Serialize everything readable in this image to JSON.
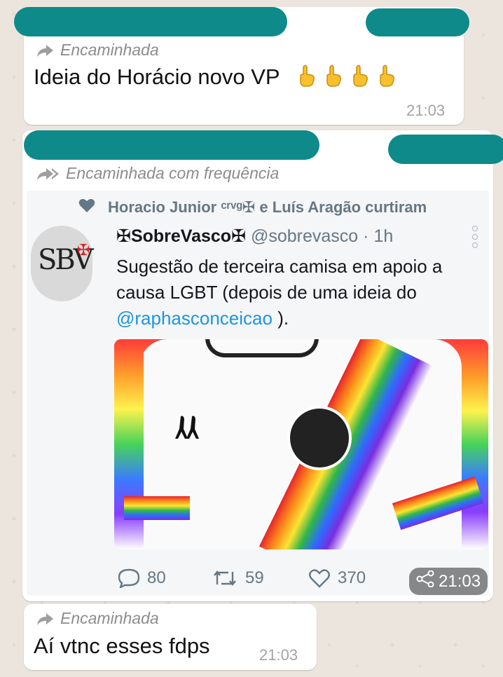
{
  "colors": {
    "bubble": "#ffffff",
    "redaction": "#0e8a8a",
    "link": "#1b95e0",
    "muted": "#8c8c8c"
  },
  "msg1": {
    "forward_label": "Encaminhada",
    "text": "Ideia do Horácio novo VP",
    "time": "21:03",
    "emoji_icons": [
      "point-up-emoji",
      "point-up-emoji",
      "point-up-emoji",
      "point-up-emoji"
    ]
  },
  "msg2": {
    "forward_label": "Encaminhada com frequência",
    "tweet": {
      "liked_by": "Horacio Junior ᶜʳᵛᵍ✠ e Luís Aragão curtiram",
      "avatar_text": "SBV",
      "name": "✠SobreVasco✠",
      "handle": "@sobrevasco",
      "age": "· 1h",
      "text_prefix": "Sugestão de terceira camisa em apoio a causa LGBT (depois de uma ideia do ",
      "mention": "@raphasconceicao",
      "text_suffix": " ).",
      "replies": "80",
      "retweets": "59",
      "likes": "370"
    },
    "time": "21:03"
  },
  "msg3": {
    "forward_label": "Encaminhada",
    "text": "Aí vtnc esses fdps",
    "time": "21:03"
  }
}
